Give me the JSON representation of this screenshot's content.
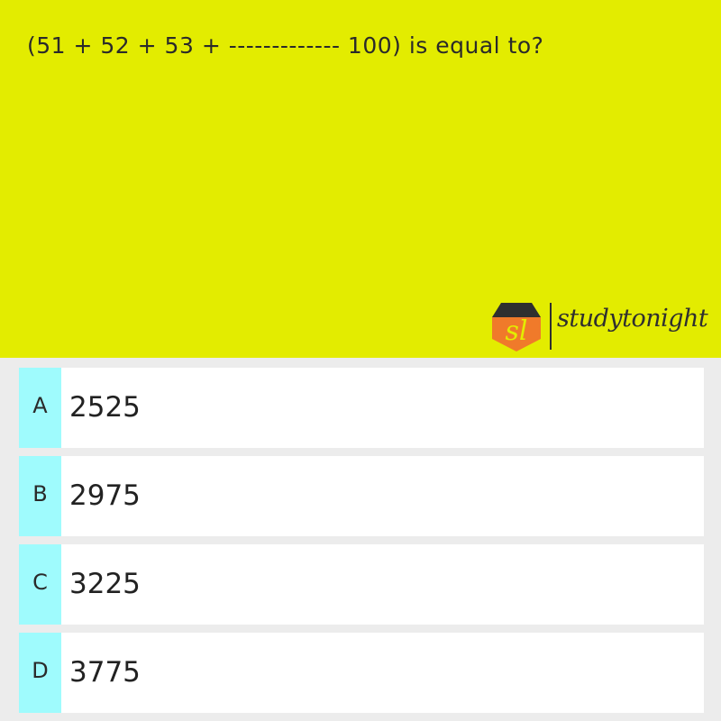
{
  "question": {
    "text": "(51 + 52 + 53 + ------------- 100) is equal to?"
  },
  "brand": {
    "badge_text": "sl",
    "wordmark": "studytonight",
    "colors": {
      "panel": "#e3ec00",
      "badge_top": "#2f2f2f",
      "badge_bottom": "#f07a2a",
      "badge_letters": "#e3ec00"
    }
  },
  "options": [
    {
      "letter": "A",
      "value": "2525"
    },
    {
      "letter": "B",
      "value": "2975"
    },
    {
      "letter": "C",
      "value": "3225"
    },
    {
      "letter": "D",
      "value": "3775"
    }
  ],
  "colors": {
    "option_letter_bg": "#9ffbfd",
    "option_bg": "#ffffff",
    "page_bg": "#ececec"
  }
}
